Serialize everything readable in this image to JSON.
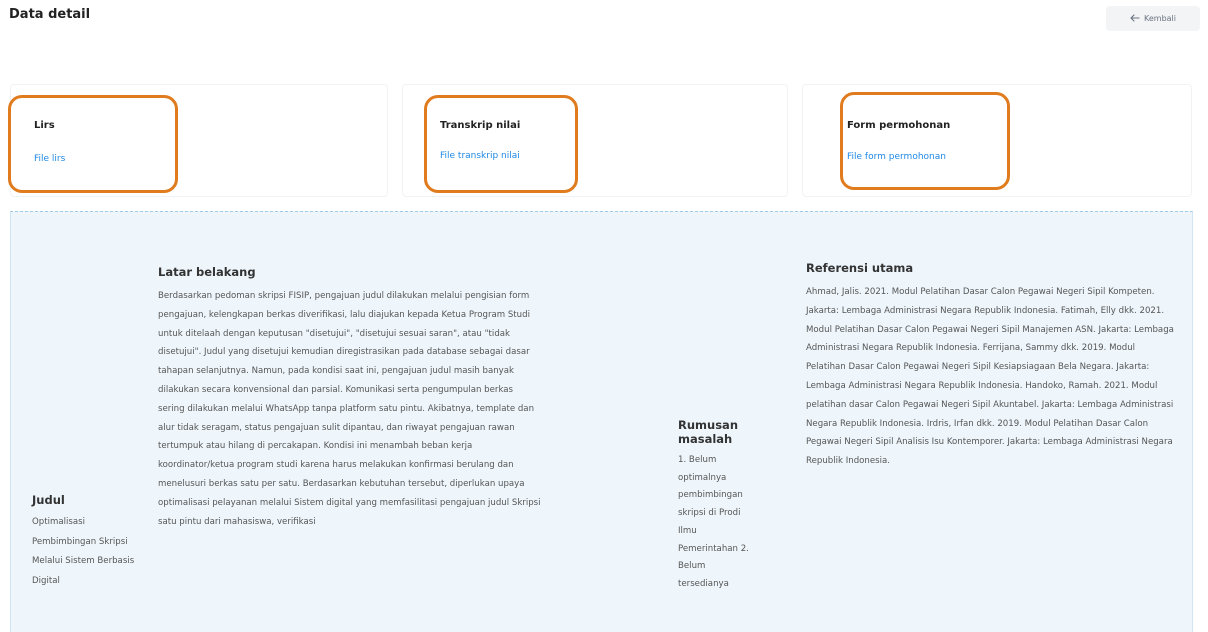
{
  "header": {
    "title": "Data detail",
    "back_label": "Kembali",
    "back_icon": "arrow-left-icon"
  },
  "cards": [
    {
      "title": "Lirs",
      "link": "File lirs"
    },
    {
      "title": "Transkrip nilai",
      "link": "File transkrip nilai"
    },
    {
      "title": "Form permohonan",
      "link": "File form permohonan"
    }
  ],
  "detail": {
    "judul": {
      "label": "Judul",
      "value": "Optimalisasi Pembimbingan Skripsi Melalui Sistem Berbasis Digital"
    },
    "latar_belakang": {
      "label": "Latar belakang",
      "value": "Berdasarkan pedoman skripsi FISIP, pengajuan judul dilakukan melalui pengisian form pengajuan, kelengkapan berkas diverifikasi, lalu diajukan kepada Ketua Program Studi untuk ditelaah dengan keputusan \"disetujui\", \"disetujui sesuai saran\", atau \"tidak disetujui\". Judul yang disetujui kemudian diregistrasikan pada database sebagai dasar tahapan selanjutnya. Namun, pada kondisi saat ini, pengajuan judul masih banyak dilakukan secara konvensional dan parsial. Komunikasi serta pengumpulan berkas sering dilakukan melalui WhatsApp tanpa platform satu pintu. Akibatnya, template dan alur tidak seragam, status pengajuan sulit dipantau, dan riwayat pengajuan rawan tertumpuk atau hilang di percakapan. Kondisi ini menambah beban kerja koordinator/ketua program studi karena harus melakukan konfirmasi berulang dan menelusuri berkas satu per satu. Berdasarkan kebutuhan tersebut, diperlukan upaya optimalisasi pelayanan melalui Sistem digital yang memfasilitasi pengajuan judul Skripsi satu pintu dari mahasiswa, verifikasi"
    },
    "rumusan_masalah": {
      "label": "Rumusan masalah",
      "value": "1. Belum optimalnya pembimbingan skripsi di Prodi Ilmu Pemerintahan 2. Belum tersedianya"
    },
    "referensi_utama": {
      "label": "Referensi utama",
      "value": "Ahmad, Jalis. 2021. Modul Pelatihan Dasar Calon Pegawai Negeri Sipil Kompeten. Jakarta: Lembaga Administrasi Negara Republik Indonesia. Fatimah, Elly dkk. 2021. Modul Pelatihan Dasar Calon Pegawai Negeri Sipil Manajemen ASN. Jakarta: Lembaga Administrasi Negara Republik Indonesia. Ferrijana, Sammy dkk. 2019. Modul Pelatihan Dasar Calon Pegawai Negeri Sipil Kesiapsiagaan Bela Negara. Jakarta: Lembaga Administrasi Negara Republik Indonesia. Handoko, Ramah. 2021. Modul pelatihan dasar Calon Pegawai Negeri Sipil Akuntabel. Jakarta: Lembaga Administrasi Negara Republik Indonesia. Irdris, Irfan dkk. 2019. Modul Pelatihan Dasar Calon Pegawai Negeri Sipil Analisis Isu Kontemporer. Jakarta: Lembaga Administrasi Negara Republik Indonesia."
    }
  }
}
